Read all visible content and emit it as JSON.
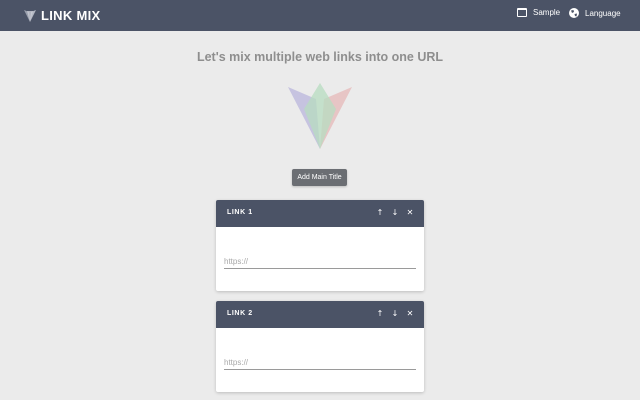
{
  "app": {
    "title": "LINK MIX",
    "logo_icon": "fox-logo-icon"
  },
  "nav": {
    "sample_label": "Sample",
    "sample_icon": "window-icon",
    "language_label": "Language",
    "language_icon": "globe-icon"
  },
  "headline": "Let's mix multiple web links into one URL",
  "hero": {
    "logo_icon": "fox-logo-icon"
  },
  "add_main_title_label": "Add Main Title",
  "links": [
    {
      "label": "LINK 1",
      "url_value": "",
      "url_placeholder": "https://"
    },
    {
      "label": "LINK 2",
      "url_value": "",
      "url_placeholder": "https://"
    }
  ],
  "card_actions": {
    "up_icon": "arrow-up-icon",
    "down_icon": "arrow-down-icon",
    "remove_icon": "close-icon"
  },
  "colors": {
    "header_bg": "#4b5366",
    "page_bg": "#ebebeb",
    "button_bg": "#6b6e73",
    "logo_purple": "#b9b6dc",
    "logo_green": "#b7dcc0",
    "logo_red": "#e6b8b8"
  }
}
